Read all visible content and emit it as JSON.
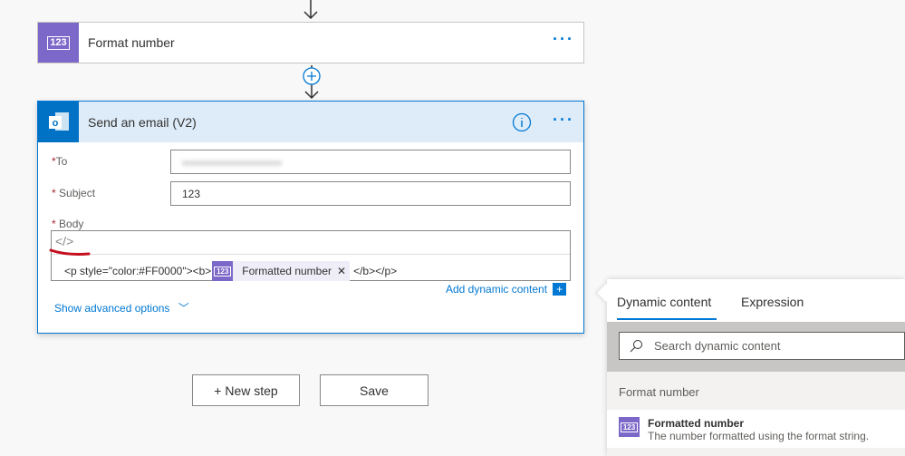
{
  "flow": {
    "format_card": {
      "title": "Format number",
      "icon": "123-icon"
    },
    "email_card": {
      "title": "Send an email (V2)",
      "icon": "outlook-icon",
      "fields": {
        "to_label": "To",
        "to_value": "",
        "subject_label": "Subject",
        "subject_value": "123",
        "body_label": "Body",
        "body_prefix": "<p style=\"color:#FF0000\"><b>",
        "token_label": "Formatted number",
        "body_suffix": "</b></p>"
      },
      "add_dynamic": "Add dynamic content",
      "advanced": "Show advanced options"
    },
    "buttons": {
      "new_step": "+ New step",
      "save": "Save"
    }
  },
  "panel": {
    "tabs": [
      "Dynamic content",
      "Expression"
    ],
    "search_placeholder": "Search dynamic content",
    "section": "Format number",
    "item": {
      "title": "Formatted number",
      "desc": "The number formatted using the format string."
    }
  },
  "colors": {
    "accent": "#0078d4",
    "purple": "#7b68c8",
    "header": "#deecf9",
    "annotation": "#c50f1f"
  }
}
